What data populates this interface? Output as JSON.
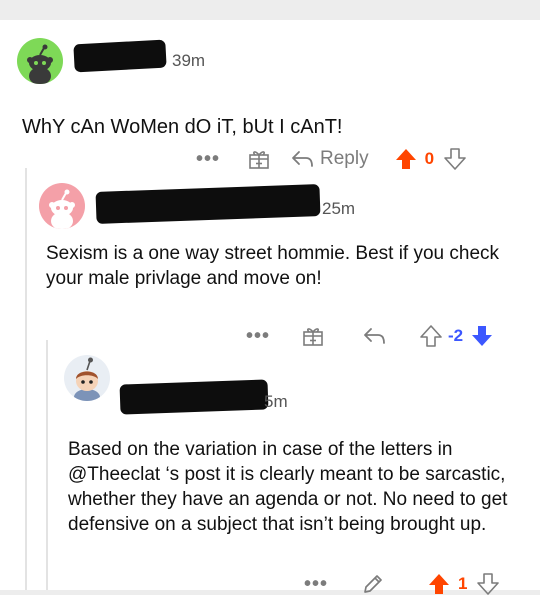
{
  "comments": [
    {
      "username": "",
      "time": "39m",
      "text": "WhY cAn WoMen dO iT, bUt I cAnT!",
      "reply_label": "Reply",
      "vote_count": "0",
      "vote_state": "upvoted"
    },
    {
      "username": "",
      "time": "25m",
      "text": "Sexism is a one way street hommie. Best if you check your male privlage and move on!",
      "vote_count": "-2",
      "vote_state": "downvoted"
    },
    {
      "username": "",
      "time": "5m",
      "text": "Based on the variation in case of the letters in @Theeclat ‘s post it is clearly meant to be sarcastic, whether they have an agenda or not. No need to get defensive on a subject that isn’t being brought up.",
      "vote_count": "1",
      "vote_state": "upvoted"
    }
  ],
  "colors": {
    "upvote": "#ff4500",
    "downvote": "#3c57ff",
    "avatar_green": "#7ed957",
    "avatar_pink": "#f4a0a8"
  },
  "icons": [
    "more-dots-icon",
    "gift-icon",
    "reply-arrow-icon",
    "upvote-arrow-icon",
    "downvote-arrow-icon",
    "edit-pencil-icon"
  ]
}
